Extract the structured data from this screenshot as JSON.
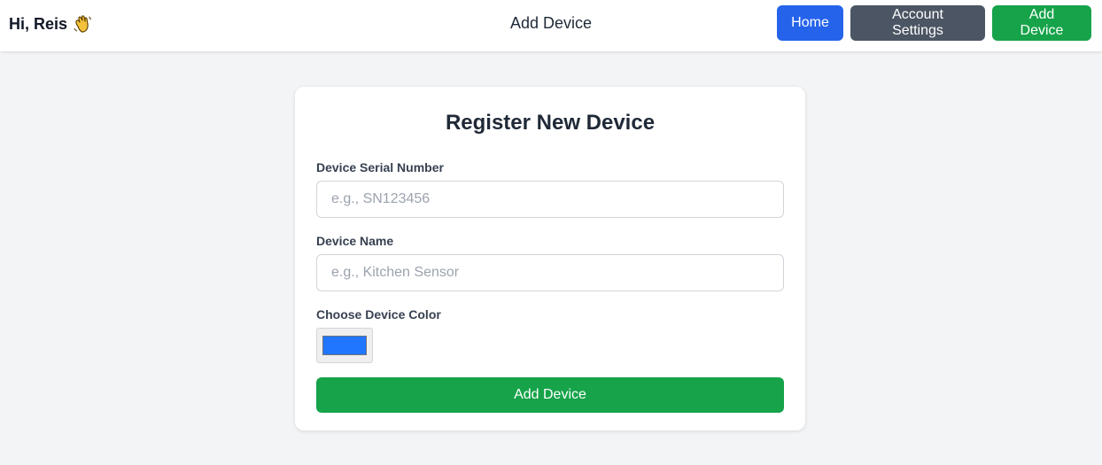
{
  "header": {
    "greeting": "Hi, Reis",
    "greeting_icon": "waving-hand-icon",
    "page_title": "Add Device",
    "nav": {
      "home_label": "Home",
      "account_settings_label": "Account Settings",
      "add_device_label": "Add Device"
    }
  },
  "form": {
    "title": "Register New Device",
    "serial": {
      "label": "Device Serial Number",
      "placeholder": "e.g., SN123456",
      "value": ""
    },
    "name": {
      "label": "Device Name",
      "placeholder": "e.g., Kitchen Sensor",
      "value": ""
    },
    "color": {
      "label": "Choose Device Color",
      "value": "#2176ff"
    },
    "submit_label": "Add Device"
  },
  "colors": {
    "home_button": "#2563eb",
    "account_button": "#4b5563",
    "add_button": "#16a34a",
    "background": "#f3f4f6"
  }
}
